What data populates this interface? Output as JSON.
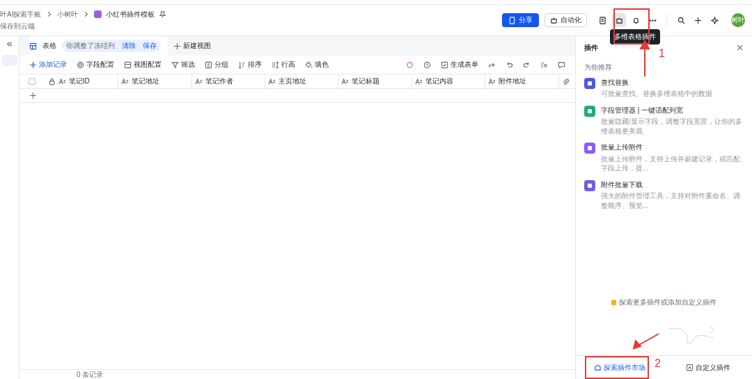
{
  "breadcrumb": {
    "items": [
      "叶AI探索手账",
      "小树叶"
    ],
    "doc_title": "小红书插件模板",
    "save_status": "保存到云端"
  },
  "header": {
    "share": "分享",
    "automation": "自动化",
    "tooltip": "多维表格插件",
    "avatar": "树叶",
    "icons": [
      {
        "kind": "doc",
        "selected": false
      },
      {
        "kind": "plugin",
        "selected": true
      },
      {
        "kind": "bell",
        "selected": false
      },
      {
        "kind": "more",
        "selected": false
      }
    ]
  },
  "view_bar": {
    "view": "表格",
    "notice": "你调整了冻结列",
    "clear": "清除",
    "save": "保存",
    "new_view": "新建视图"
  },
  "toolbar": {
    "left": [
      {
        "kind": "add",
        "label": "添加记录"
      },
      {
        "kind": "gear",
        "label": "字段配置"
      },
      {
        "kind": "view",
        "label": "视图配置"
      },
      {
        "kind": "filter",
        "label": "筛选"
      },
      {
        "kind": "group",
        "label": "分组"
      },
      {
        "kind": "sort",
        "label": "排序"
      },
      {
        "kind": "height",
        "label": "行高"
      },
      {
        "kind": "fill",
        "label": "填色"
      }
    ],
    "form": "生成表单"
  },
  "table": {
    "select_all_checked": false,
    "columns": [
      {
        "label": "笔记ID",
        "locked": true
      },
      {
        "label": "笔记地址",
        "locked": false
      },
      {
        "label": "笔记作者",
        "locked": false
      },
      {
        "label": "主页地址",
        "locked": false
      },
      {
        "label": "笔记标题",
        "locked": false
      },
      {
        "label": "笔记内容",
        "locked": false
      },
      {
        "label": "附件地址",
        "locked": false
      }
    ],
    "footer": "0 条记录"
  },
  "plugin_panel": {
    "title": "插件",
    "section": "为你推荐",
    "plugins": [
      {
        "name": "查找替换",
        "description": "可批量查找、替换多维表格中的数据",
        "color": "#4e5bd9"
      },
      {
        "name": "字段管理器 | 一键适配列宽",
        "description": "批量隐藏/显示字段，调整字段宽度，让你的多维表格更美观",
        "color": "#1fae6a"
      },
      {
        "name": "批量上传附件",
        "description": "批量上传附件，支持上传并新建记录，或匹配字段上传，提...",
        "color": "#8b5cf6"
      },
      {
        "name": "附件批量下载",
        "description": "强大的附件管理工具，支持对附件重命名、调整顺序、预览...",
        "color": "#6d5fe8"
      }
    ],
    "explore_hint": "探索更多插件或添加自定义插件",
    "market": "探索插件市场",
    "custom": "自定义插件"
  },
  "annotations": [
    {
      "label": "1"
    },
    {
      "label": "2"
    }
  ]
}
